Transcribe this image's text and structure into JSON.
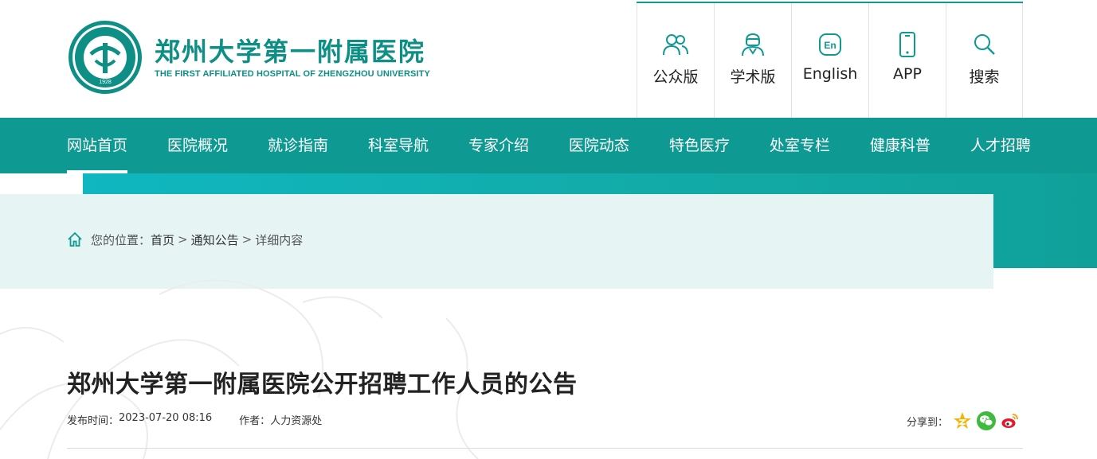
{
  "header": {
    "logo_cn": "郑州大学第一附属医院",
    "logo_en": "THE FIRST AFFILIATED HOSPITAL OF ZHENGZHOU UNIVERSITY",
    "seal_year": "1928",
    "tools": [
      {
        "label": "公众版",
        "icon": "people-icon"
      },
      {
        "label": "学术版",
        "icon": "doctor-icon"
      },
      {
        "label": "English",
        "icon": "en-icon"
      },
      {
        "label": "APP",
        "icon": "phone-icon"
      },
      {
        "label": "搜索",
        "icon": "search-icon"
      }
    ]
  },
  "nav": {
    "items": [
      "网站首页",
      "医院概况",
      "就诊指南",
      "科室导航",
      "专家介绍",
      "医院动态",
      "特色医疗",
      "处室专栏",
      "健康科普",
      "人才招聘"
    ],
    "active_index": 0
  },
  "breadcrumb": {
    "prefix": "您的位置：",
    "home": "首页",
    "sep1": ">",
    "section": "通知公告",
    "sep2": ">",
    "current": "详细内容"
  },
  "article": {
    "title": "郑州大学第一附属医院公开招聘工作人员的公告",
    "publish_label": "发布时间：",
    "publish_time": "2023-07-20 08:16",
    "author_label": "作者：",
    "author": "人力资源处",
    "share_label": "分享到："
  },
  "colors": {
    "brand": "#0e9a92",
    "banner": "#10b7c0",
    "crumb_bg": "#e6f4f4"
  }
}
